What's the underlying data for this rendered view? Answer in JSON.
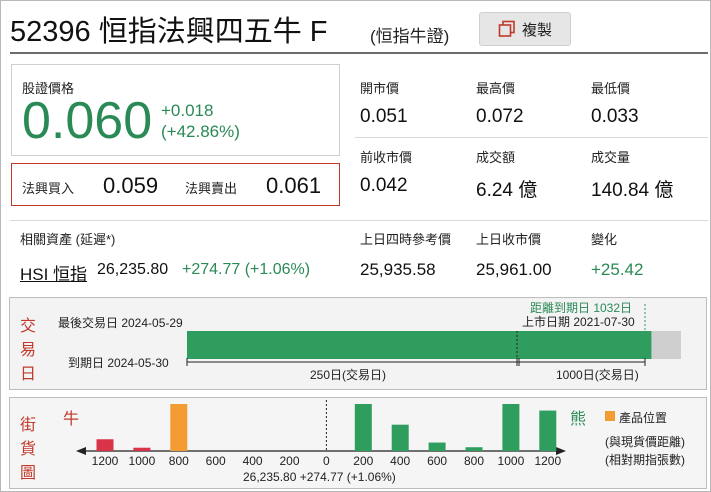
{
  "header": {
    "title": "52396 恒指法興四五牛 F",
    "subtitle": "(恒指牛證)",
    "copy_label": "複製"
  },
  "price": {
    "label": "股證價格",
    "value": "0.060",
    "change": "+0.018",
    "change_pct": "(+42.86%)"
  },
  "bid_ask": {
    "bid_label": "法興買入",
    "bid": "0.059",
    "ask_label": "法興賣出",
    "ask": "0.061"
  },
  "stats": [
    {
      "label": "開市價",
      "value": "0.051"
    },
    {
      "label": "最高價",
      "value": "0.072"
    },
    {
      "label": "最低價",
      "value": "0.033"
    },
    {
      "label": "前收市價",
      "value": "0.042"
    },
    {
      "label": "成交額",
      "value": "6.24 億"
    },
    {
      "label": "成交量",
      "value": "140.84 億"
    }
  ],
  "underlying": {
    "label": "相關資產 (延遲*)",
    "link": "HSI 恒指",
    "price": "26,235.80",
    "change": "+274.77 (+1.06%)",
    "ref4pm_label": "上日四時參考價",
    "ref4pm": "25,935.58",
    "prevclose_label": "上日收市價",
    "prevclose": "25,961.00",
    "diff_label": "變化",
    "diff": "+25.42"
  },
  "trading": {
    "section_label": [
      "交",
      "易",
      "日"
    ],
    "last_trade": "最後交易日 2024-05-29",
    "expiry": "到期日 2024-05-30",
    "days_to_expiry": "距離到期日 1032日",
    "listing": "上市日期 2021-07-30",
    "span1": "250日(交易日)",
    "span2": "1000日(交易日)",
    "elapsed_fraction": 0.06
  },
  "street": {
    "section_label": [
      "街",
      "貨",
      "圖"
    ],
    "bull_label": "牛",
    "bear_label": "熊",
    "legend_label": "產品位置",
    "note1": "(與現貨價距離)",
    "note2": "(相對期指張數)",
    "axis_ticks": [
      "1200",
      "1000",
      "800",
      "600",
      "400",
      "200",
      "0",
      "200",
      "400",
      "600",
      "800",
      "1000",
      "1200"
    ],
    "spot": "26,235.80 +274.77 (+1.06%)",
    "colors": {
      "bull": "#d9334a",
      "bear": "#2e9d5e",
      "product": "#f39c34"
    }
  },
  "chart_data": {
    "type": "bar",
    "categories": [
      "1200",
      "1000",
      "800",
      "600",
      "400",
      "200",
      "0",
      "200",
      "400",
      "600",
      "800",
      "1000",
      "1200"
    ],
    "series": [
      {
        "values": [
          0.25,
          0.07,
          1.0,
          0,
          0,
          0,
          0,
          0,
          0,
          0,
          0,
          0,
          0
        ]
      },
      {
        "values": [
          0,
          0,
          0,
          0,
          0,
          0,
          0,
          1.0,
          0.56,
          0.18,
          0.08,
          1.0,
          0.86
        ]
      }
    ]
  }
}
